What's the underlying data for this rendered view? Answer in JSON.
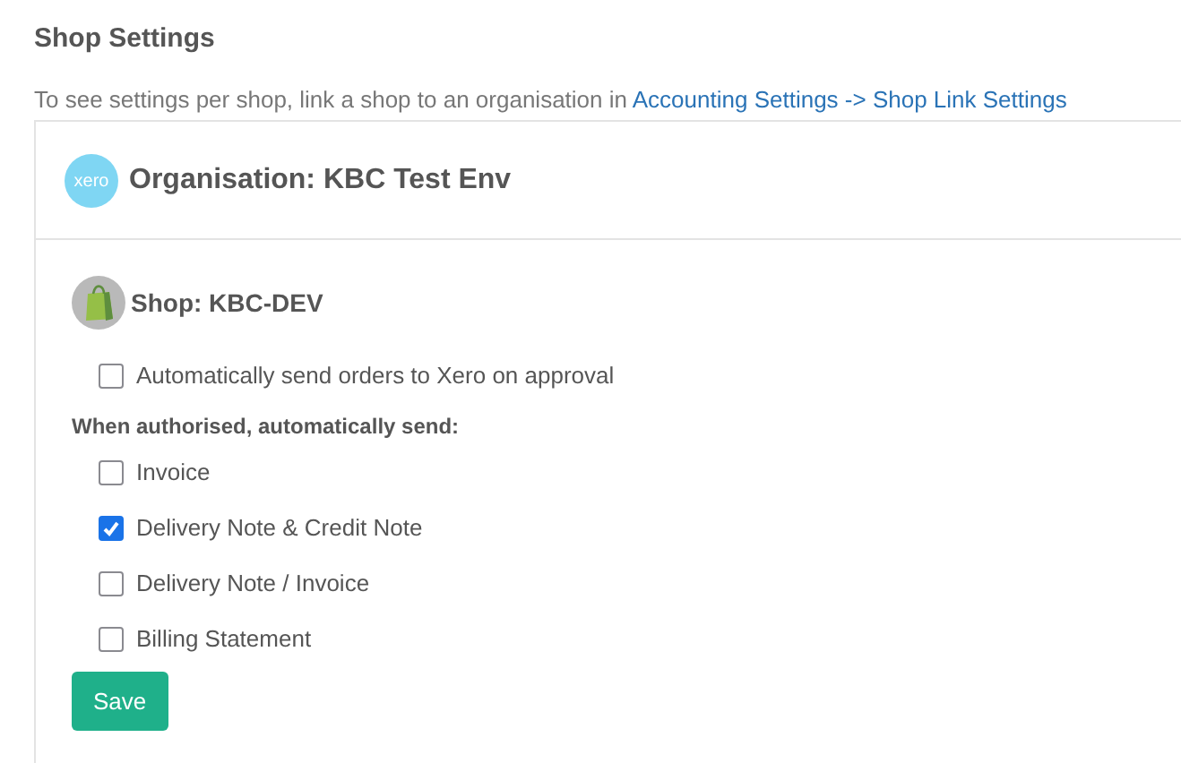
{
  "page_title": "Shop Settings",
  "intro": {
    "text": "To see settings per shop, link a shop to an organisation in",
    "link": "Accounting Settings -> Shop Link Settings"
  },
  "organisation": {
    "logo_text": "xero",
    "title": "Organisation: KBC Test Env"
  },
  "shop": {
    "title": "Shop: KBC-DEV",
    "auto_send": {
      "label": "Automatically send orders to Xero on approval",
      "checked": false
    },
    "section_label": "When authorised, automatically send:",
    "options": [
      {
        "label": "Invoice",
        "checked": false
      },
      {
        "label": "Delivery Note & Credit Note",
        "checked": true
      },
      {
        "label": "Delivery Note / Invoice",
        "checked": false
      },
      {
        "label": "Billing Statement",
        "checked": false
      }
    ]
  },
  "buttons": [
    "Save"
  ]
}
